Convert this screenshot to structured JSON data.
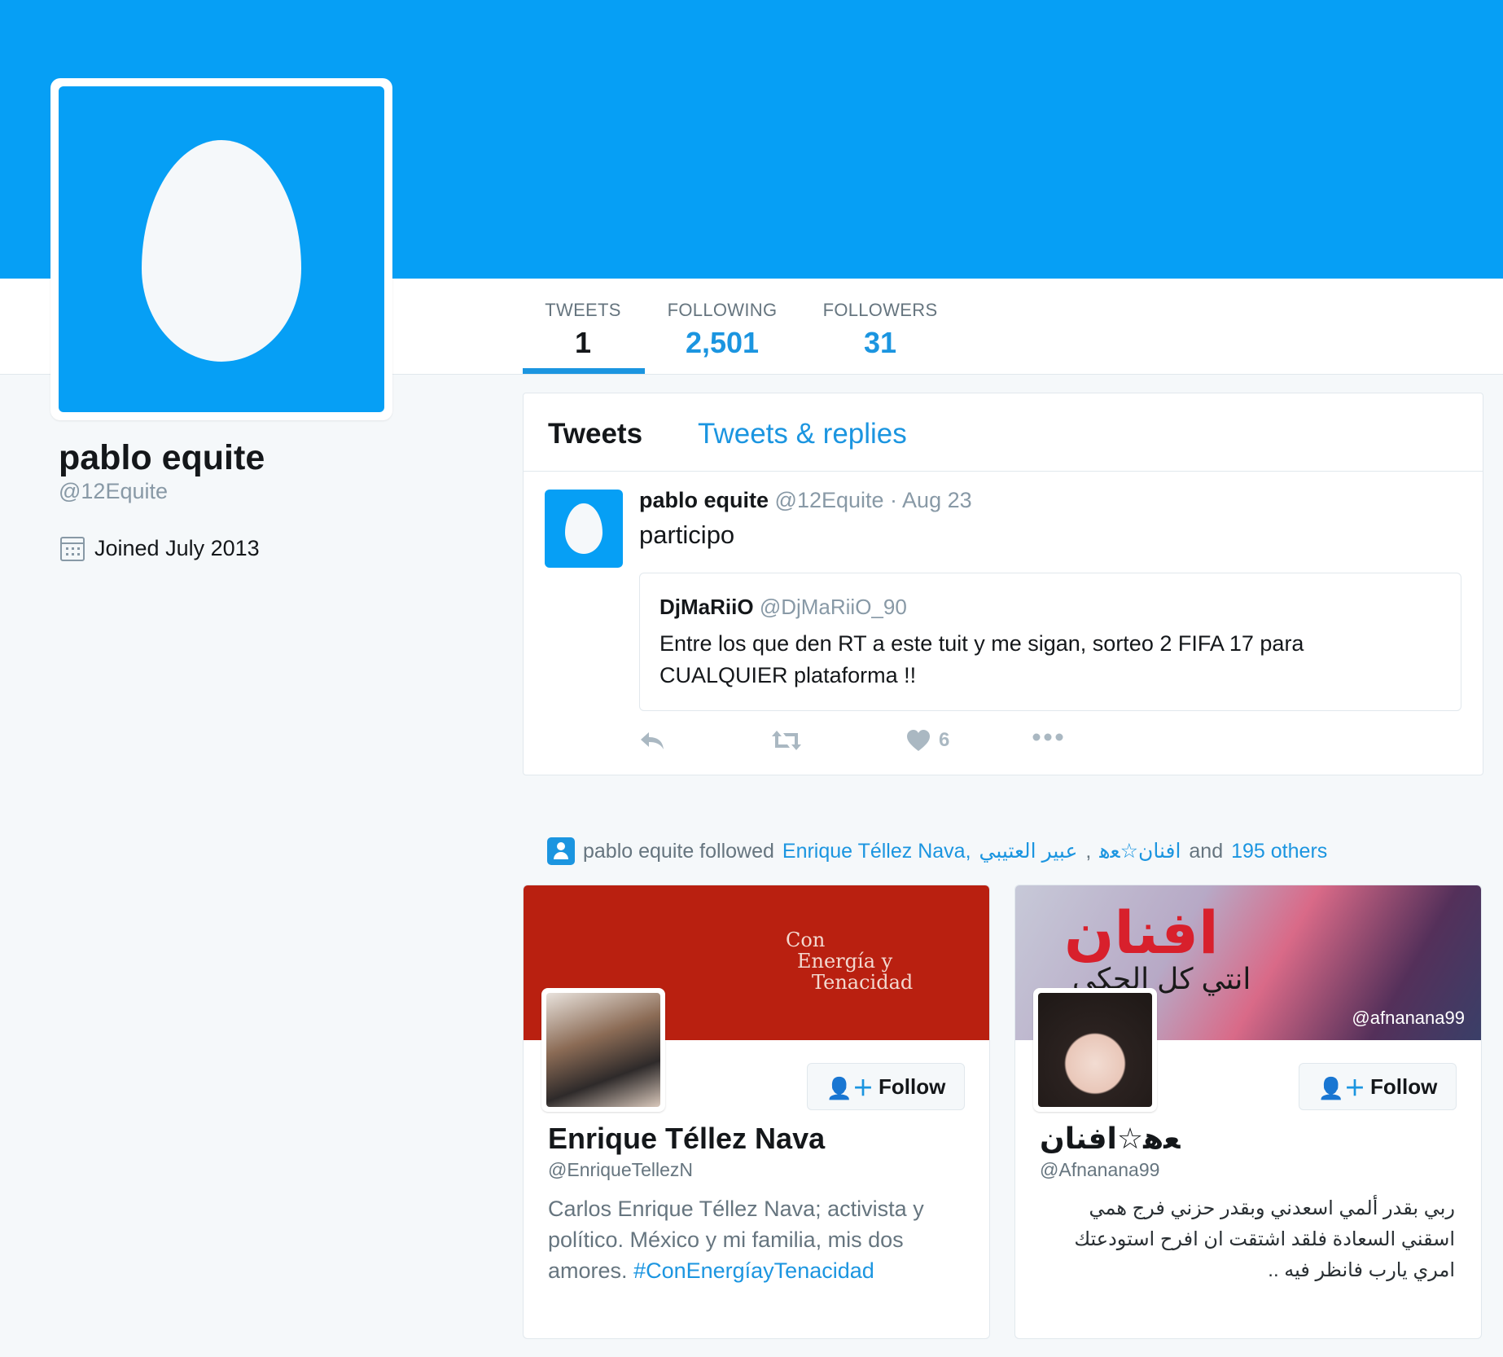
{
  "profile": {
    "name": "pablo equite",
    "handle": "@12Equite",
    "joined": "Joined July 2013"
  },
  "stats": {
    "tweets_label": "TWEETS",
    "tweets_value": "1",
    "following_label": "FOLLOWING",
    "following_value": "2,501",
    "followers_label": "FOLLOWERS",
    "followers_value": "31"
  },
  "timeline": {
    "tab_tweets": "Tweets",
    "tab_replies": "Tweets & replies"
  },
  "tweet": {
    "author": "pablo equite",
    "handle": "@12Equite",
    "separator": " · ",
    "date": "Aug 23",
    "text": "participo",
    "quote": {
      "author": "DjMaRiiO",
      "handle": "@DjMaRiiO_90",
      "text": "Entre los que den RT a este tuit y me sigan, sorteo 2 FIFA 17 para CUALQUIER plataforma !!"
    },
    "like_count": "6"
  },
  "followed": {
    "prefix": "pablo equite followed",
    "name1": "Enrique Téllez Nava",
    "comma1": ",",
    "name2": "عبير العتيبي",
    "comma2": ",",
    "name3": "افنان☆ﻌﮬ",
    "and_text": "and",
    "others": "195 others"
  },
  "cards": [
    {
      "banner_line1": "Con",
      "banner_line2": "Energía y",
      "banner_line3": "Tenacidad",
      "name": "Enrique Téllez Nava",
      "handle": "@EnriqueTellezN",
      "bio": "Carlos Enrique Téllez Nava; activista y político. México y mi familia, mis dos amores.",
      "bio_hashtag": "#ConEnergíayTenacidad",
      "follow_label": "Follow"
    },
    {
      "banner_big": "افنان",
      "banner_sub": "انتي كل الحكي",
      "banner_handle": "@afnanana99",
      "name": "ﻌﮬ☆افنان",
      "handle": "@Afnanana99",
      "bio": "ربي بقدر ألمي اسعدني وبقدر حزني فرج همي اسقني السعادة فلقد اشتقت ان افرح استودعتك امري يارب فانظر فيه ..",
      "follow_label": "Follow"
    }
  ],
  "colors": {
    "brand_blue": "#069ff5",
    "link_blue": "#1b95e0",
    "card1_banner": "#b92010"
  }
}
